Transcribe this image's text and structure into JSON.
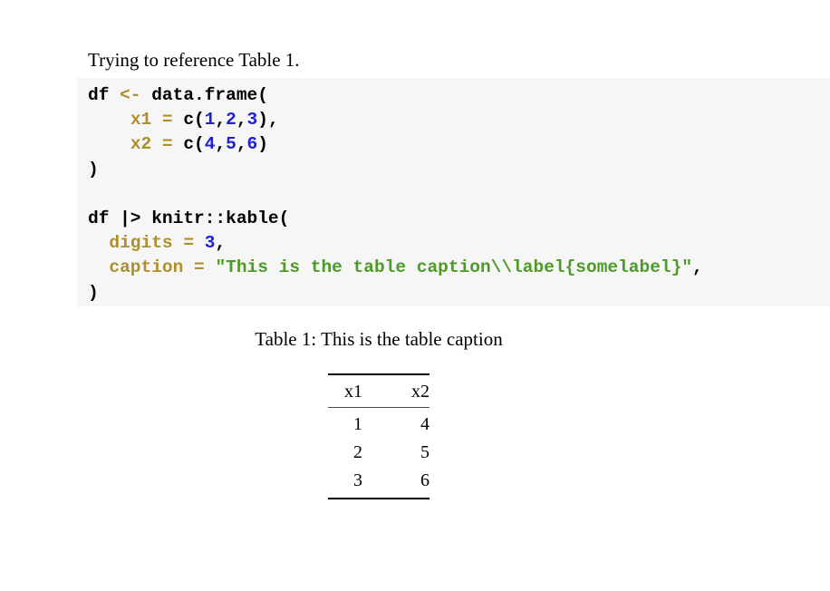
{
  "document": {
    "paragraph": "Trying to reference Table 1.",
    "code_block": {
      "language": "r",
      "background_color": "#f6f6f6",
      "colors": {
        "plain": "#000000",
        "identifier": "#ad8f2e",
        "number": "#2020d0",
        "string": "#4e9a26"
      },
      "lines": [
        {
          "tokens": [
            {
              "text": "df ",
              "type": "plain"
            },
            {
              "text": "<-",
              "type": "identifier"
            },
            {
              "text": " data.frame(",
              "type": "plain"
            }
          ]
        },
        {
          "tokens": [
            {
              "text": "    ",
              "type": "plain"
            },
            {
              "text": "x1",
              "type": "identifier"
            },
            {
              "text": " ",
              "type": "plain"
            },
            {
              "text": "=",
              "type": "identifier"
            },
            {
              "text": " c(",
              "type": "plain"
            },
            {
              "text": "1",
              "type": "number"
            },
            {
              "text": ",",
              "type": "plain"
            },
            {
              "text": "2",
              "type": "number"
            },
            {
              "text": ",",
              "type": "plain"
            },
            {
              "text": "3",
              "type": "number"
            },
            {
              "text": "),",
              "type": "plain"
            }
          ]
        },
        {
          "tokens": [
            {
              "text": "    ",
              "type": "plain"
            },
            {
              "text": "x2",
              "type": "identifier"
            },
            {
              "text": " ",
              "type": "plain"
            },
            {
              "text": "=",
              "type": "identifier"
            },
            {
              "text": " c(",
              "type": "plain"
            },
            {
              "text": "4",
              "type": "number"
            },
            {
              "text": ",",
              "type": "plain"
            },
            {
              "text": "5",
              "type": "number"
            },
            {
              "text": ",",
              "type": "plain"
            },
            {
              "text": "6",
              "type": "number"
            },
            {
              "text": ")",
              "type": "plain"
            }
          ]
        },
        {
          "tokens": [
            {
              "text": ")",
              "type": "plain"
            }
          ]
        },
        {
          "tokens": []
        },
        {
          "tokens": [
            {
              "text": "df |> knitr::kable(",
              "type": "plain"
            }
          ]
        },
        {
          "tokens": [
            {
              "text": "  ",
              "type": "plain"
            },
            {
              "text": "digits",
              "type": "identifier"
            },
            {
              "text": " ",
              "type": "plain"
            },
            {
              "text": "=",
              "type": "identifier"
            },
            {
              "text": " ",
              "type": "plain"
            },
            {
              "text": "3",
              "type": "number"
            },
            {
              "text": ",",
              "type": "plain"
            }
          ]
        },
        {
          "tokens": [
            {
              "text": "  ",
              "type": "plain"
            },
            {
              "text": "caption",
              "type": "identifier"
            },
            {
              "text": " ",
              "type": "plain"
            },
            {
              "text": "=",
              "type": "identifier"
            },
            {
              "text": " ",
              "type": "plain"
            },
            {
              "text": "\"This is the table caption\\\\label{somelabel}\"",
              "type": "string"
            },
            {
              "text": ",",
              "type": "plain"
            }
          ]
        },
        {
          "tokens": [
            {
              "text": ")",
              "type": "plain"
            }
          ]
        }
      ]
    },
    "table": {
      "caption": "Table 1: This is the table caption",
      "columns": [
        "x1",
        "x2"
      ],
      "rows": [
        [
          "1",
          "4"
        ],
        [
          "2",
          "5"
        ],
        [
          "3",
          "6"
        ]
      ]
    }
  }
}
